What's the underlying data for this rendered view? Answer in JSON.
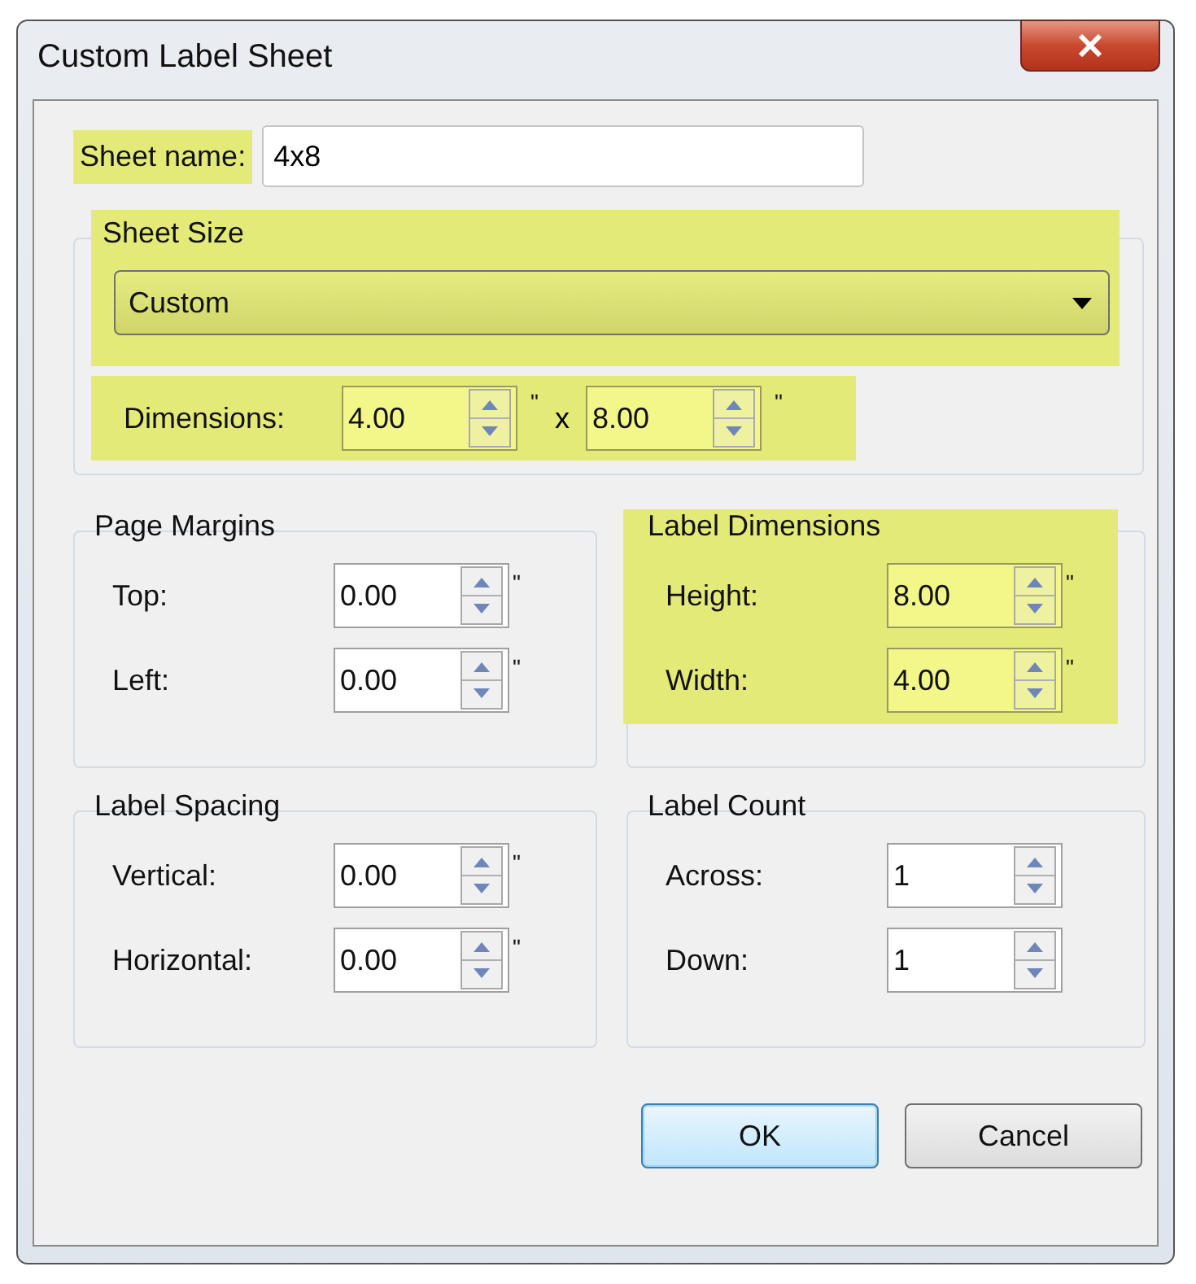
{
  "window": {
    "title": "Custom Label Sheet"
  },
  "sheet_name": {
    "label": "Sheet name:",
    "value": "4x8",
    "highlighted": true
  },
  "sheet_size": {
    "title": "Sheet Size",
    "highlighted": true,
    "dropdown": {
      "value": "Custom"
    },
    "dimensions": {
      "label": "Dimensions:",
      "highlighted": true,
      "first": {
        "value": "4.00",
        "unit": "\""
      },
      "separator": "x",
      "second": {
        "value": "8.00",
        "unit": "\""
      }
    }
  },
  "groups": [
    {
      "title": "Page Margins",
      "highlighted": false,
      "fields": [
        {
          "label": "Top:",
          "value": "0.00",
          "unit": "\""
        },
        {
          "label": "Left:",
          "value": "0.00",
          "unit": "\""
        }
      ]
    },
    {
      "title": "Label Dimensions",
      "highlighted": true,
      "fields": [
        {
          "label": "Height:",
          "value": "8.00",
          "unit": "\""
        },
        {
          "label": "Width:",
          "value": "4.00",
          "unit": "\""
        }
      ]
    },
    {
      "title": "Label Spacing",
      "highlighted": false,
      "fields": [
        {
          "label": "Vertical:",
          "value": "0.00",
          "unit": "\""
        },
        {
          "label": "Horizontal:",
          "value": "0.00",
          "unit": "\""
        }
      ]
    },
    {
      "title": "Label Count",
      "highlighted": false,
      "fields": [
        {
          "label": "Across:",
          "value": "1"
        },
        {
          "label": "Down:",
          "value": "1"
        }
      ]
    }
  ],
  "buttons": [
    {
      "label": "OK",
      "default": true
    },
    {
      "label": "Cancel",
      "default": false
    }
  ]
}
